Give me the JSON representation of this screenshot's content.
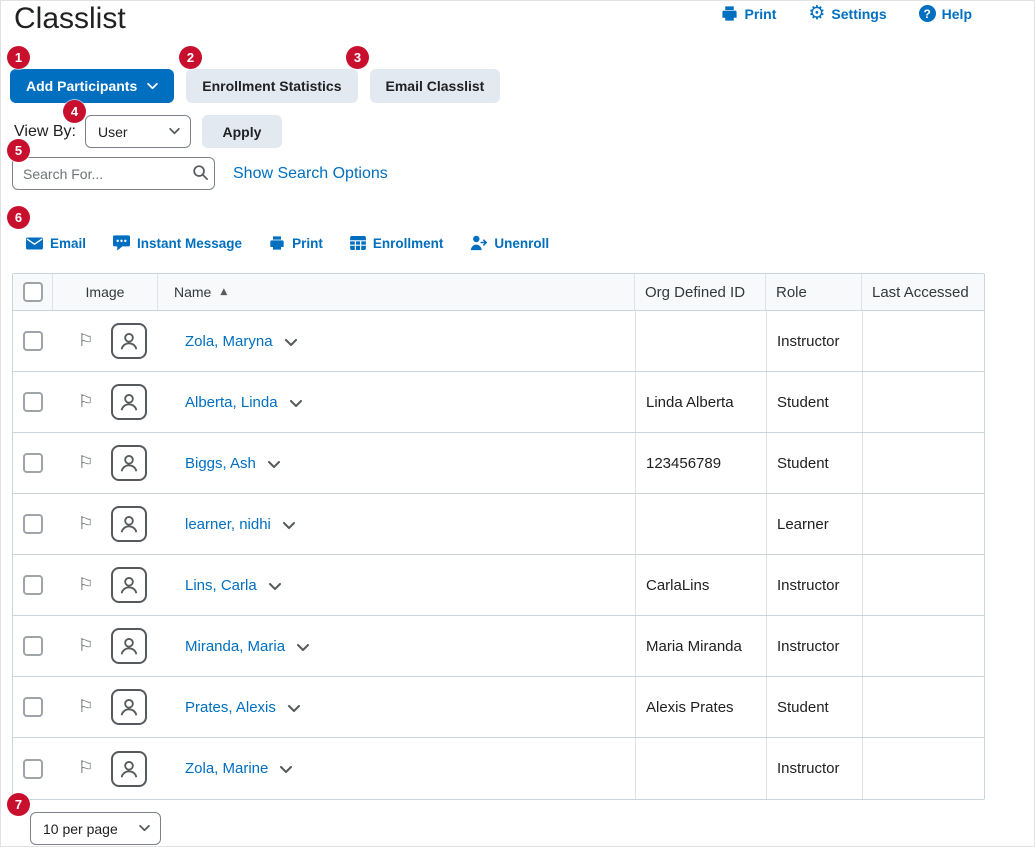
{
  "page": {
    "title": "Classlist"
  },
  "utility_nav": {
    "print": "Print",
    "settings": "Settings",
    "help": "Help"
  },
  "annotations": [
    "1",
    "2",
    "3",
    "4",
    "5",
    "6",
    "7"
  ],
  "buttons": {
    "add_participants": "Add Participants",
    "enrollment_statistics": "Enrollment Statistics",
    "email_classlist": "Email Classlist",
    "apply": "Apply"
  },
  "view_by": {
    "label": "View By:",
    "selected": "User"
  },
  "search": {
    "placeholder": "Search For...",
    "show_search_options": "Show Search Options"
  },
  "action_bar": {
    "email": "Email",
    "instant_message": "Instant Message",
    "print": "Print",
    "enrollment": "Enrollment",
    "unenroll": "Unenroll"
  },
  "table": {
    "headers": {
      "image": "Image",
      "name": "Name",
      "org_defined_id": "Org Defined ID",
      "role": "Role",
      "last_accessed": "Last Accessed"
    },
    "rows": [
      {
        "name": "Zola, Maryna",
        "org_defined_id": "",
        "role": "Instructor",
        "last_accessed": ""
      },
      {
        "name": "Alberta, Linda",
        "org_defined_id": "Linda Alberta",
        "role": "Student",
        "last_accessed": ""
      },
      {
        "name": "Biggs, Ash",
        "org_defined_id": "123456789",
        "role": "Student",
        "last_accessed": ""
      },
      {
        "name": "learner, nidhi",
        "org_defined_id": "",
        "role": "Learner",
        "last_accessed": ""
      },
      {
        "name": "Lins, Carla",
        "org_defined_id": "CarlaLins",
        "role": "Instructor",
        "last_accessed": ""
      },
      {
        "name": "Miranda, Maria",
        "org_defined_id": "Maria Miranda",
        "role": "Instructor",
        "last_accessed": ""
      },
      {
        "name": "Prates, Alexis",
        "org_defined_id": "Alexis Prates",
        "role": "Student",
        "last_accessed": ""
      },
      {
        "name": "Zola, Marine",
        "org_defined_id": "",
        "role": "Instructor",
        "last_accessed": ""
      }
    ]
  },
  "pagination": {
    "per_page": "10 per page"
  },
  "colors": {
    "primary_blue": "#006fbf",
    "badge_red": "#c8102e",
    "button_gray": "#e3e9f1",
    "table_border": "#cdd5dc"
  }
}
